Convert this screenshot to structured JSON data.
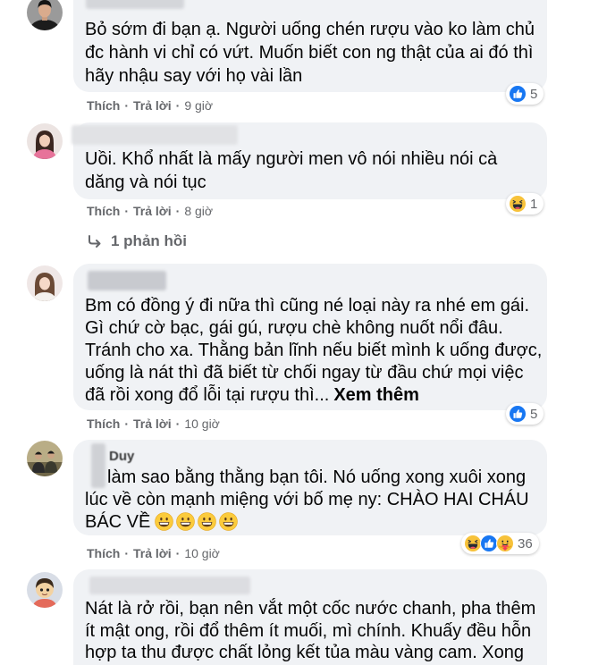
{
  "comments": [
    {
      "lines": [
        "Bỏ sớm đi bạn ạ. Người uống chén rượu vào ko làm chủ",
        "đc hành vi chỉ có vứt. Muốn biết con ng thật của ai đó thì",
        "hãy nhậu say với họ vài lần"
      ],
      "reactions": {
        "icons": [
          "like-reaction-icon"
        ],
        "count": "5"
      },
      "actions": {
        "like": "Thích",
        "reply": "Trả lời",
        "time": "9 giờ"
      }
    },
    {
      "lines": [
        "Uồi. Khổ nhất là mấy người men vô nói nhiều nói cà",
        "dăng và nói tục"
      ],
      "reactions": {
        "icons": [
          "haha-reaction-icon"
        ],
        "count": "1"
      },
      "actions": {
        "like": "Thích",
        "reply": "Trả lời",
        "time": "8 giờ"
      },
      "replies": {
        "icon": "reply-arrow-icon",
        "label": "1 phản hồi"
      }
    },
    {
      "lines": [
        "Bm có đồng ý đi nữa thì cũng né loại này ra nhé em gái.",
        "Gì chứ cờ bạc, gái gú, rượu chè không nuốt nổi đâu.",
        "Tránh cho xa. Thằng bản lĩnh nếu biết mình k uống được,",
        "uống là nát thì đã biết từ chối ngay từ đầu chứ mọi việc",
        "đã rồi xong đổ lỗi tại rượu thì..."
      ],
      "see_more": "Xem thêm",
      "reactions": {
        "icons": [
          "like-reaction-icon"
        ],
        "count": "5"
      },
      "actions": {
        "like": "Thích",
        "reply": "Trả lời",
        "time": "10 giờ"
      }
    },
    {
      "author": "Duy",
      "lines": [
        "làm sao bằng thằng bạn tôi. Nó uống xong xuôi xong",
        "lúc về còn mạnh miệng với bố mẹ ny: CHÀO HAI CHÁU",
        "BÁC VỀ"
      ],
      "line_emojis": [
        "grinning-face-emoji-icon",
        "grinning-face-emoji-icon",
        "grinning-face-emoji-icon",
        "grinning-face-emoji-icon"
      ],
      "reactions": {
        "icons": [
          "haha-reaction-icon",
          "like-reaction-icon",
          "care-reaction-icon"
        ],
        "count": "36"
      },
      "actions": {
        "like": "Thích",
        "reply": "Trả lời",
        "time": "10 giờ"
      }
    },
    {
      "lines": [
        "Nát là rở rồi, bạn nên vắt một cốc nước chanh, pha thêm",
        "ít mật ong, rồi đổ thêm ít muối, mì chính. Khuấy đều hỗn",
        "hợp ta thu được chất lỏng kết tủa màu vàng cam. Xong"
      ]
    }
  ],
  "separator": "·",
  "colors": {
    "background": "#ffffff",
    "bubble": "#f0f2f5",
    "text": "#050505",
    "secondary_text": "#65676b",
    "like_blue": "#1877f2",
    "reaction_yellow": "#f7c23a"
  }
}
